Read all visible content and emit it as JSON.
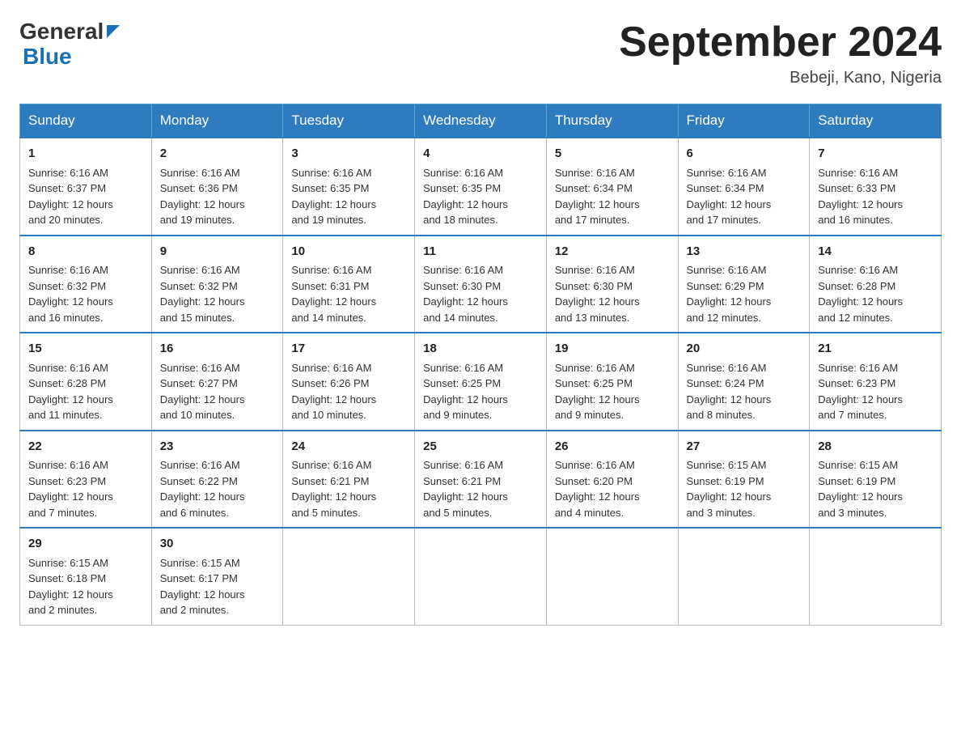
{
  "header": {
    "logo_general": "General",
    "logo_blue": "Blue",
    "month_title": "September 2024",
    "location": "Bebeji, Kano, Nigeria"
  },
  "days_of_week": [
    "Sunday",
    "Monday",
    "Tuesday",
    "Wednesday",
    "Thursday",
    "Friday",
    "Saturday"
  ],
  "weeks": [
    [
      {
        "day": "1",
        "sunrise": "6:16 AM",
        "sunset": "6:37 PM",
        "daylight": "12 hours and 20 minutes."
      },
      {
        "day": "2",
        "sunrise": "6:16 AM",
        "sunset": "6:36 PM",
        "daylight": "12 hours and 19 minutes."
      },
      {
        "day": "3",
        "sunrise": "6:16 AM",
        "sunset": "6:35 PM",
        "daylight": "12 hours and 19 minutes."
      },
      {
        "day": "4",
        "sunrise": "6:16 AM",
        "sunset": "6:35 PM",
        "daylight": "12 hours and 18 minutes."
      },
      {
        "day": "5",
        "sunrise": "6:16 AM",
        "sunset": "6:34 PM",
        "daylight": "12 hours and 17 minutes."
      },
      {
        "day": "6",
        "sunrise": "6:16 AM",
        "sunset": "6:34 PM",
        "daylight": "12 hours and 17 minutes."
      },
      {
        "day": "7",
        "sunrise": "6:16 AM",
        "sunset": "6:33 PM",
        "daylight": "12 hours and 16 minutes."
      }
    ],
    [
      {
        "day": "8",
        "sunrise": "6:16 AM",
        "sunset": "6:32 PM",
        "daylight": "12 hours and 16 minutes."
      },
      {
        "day": "9",
        "sunrise": "6:16 AM",
        "sunset": "6:32 PM",
        "daylight": "12 hours and 15 minutes."
      },
      {
        "day": "10",
        "sunrise": "6:16 AM",
        "sunset": "6:31 PM",
        "daylight": "12 hours and 14 minutes."
      },
      {
        "day": "11",
        "sunrise": "6:16 AM",
        "sunset": "6:30 PM",
        "daylight": "12 hours and 14 minutes."
      },
      {
        "day": "12",
        "sunrise": "6:16 AM",
        "sunset": "6:30 PM",
        "daylight": "12 hours and 13 minutes."
      },
      {
        "day": "13",
        "sunrise": "6:16 AM",
        "sunset": "6:29 PM",
        "daylight": "12 hours and 12 minutes."
      },
      {
        "day": "14",
        "sunrise": "6:16 AM",
        "sunset": "6:28 PM",
        "daylight": "12 hours and 12 minutes."
      }
    ],
    [
      {
        "day": "15",
        "sunrise": "6:16 AM",
        "sunset": "6:28 PM",
        "daylight": "12 hours and 11 minutes."
      },
      {
        "day": "16",
        "sunrise": "6:16 AM",
        "sunset": "6:27 PM",
        "daylight": "12 hours and 10 minutes."
      },
      {
        "day": "17",
        "sunrise": "6:16 AM",
        "sunset": "6:26 PM",
        "daylight": "12 hours and 10 minutes."
      },
      {
        "day": "18",
        "sunrise": "6:16 AM",
        "sunset": "6:25 PM",
        "daylight": "12 hours and 9 minutes."
      },
      {
        "day": "19",
        "sunrise": "6:16 AM",
        "sunset": "6:25 PM",
        "daylight": "12 hours and 9 minutes."
      },
      {
        "day": "20",
        "sunrise": "6:16 AM",
        "sunset": "6:24 PM",
        "daylight": "12 hours and 8 minutes."
      },
      {
        "day": "21",
        "sunrise": "6:16 AM",
        "sunset": "6:23 PM",
        "daylight": "12 hours and 7 minutes."
      }
    ],
    [
      {
        "day": "22",
        "sunrise": "6:16 AM",
        "sunset": "6:23 PM",
        "daylight": "12 hours and 7 minutes."
      },
      {
        "day": "23",
        "sunrise": "6:16 AM",
        "sunset": "6:22 PM",
        "daylight": "12 hours and 6 minutes."
      },
      {
        "day": "24",
        "sunrise": "6:16 AM",
        "sunset": "6:21 PM",
        "daylight": "12 hours and 5 minutes."
      },
      {
        "day": "25",
        "sunrise": "6:16 AM",
        "sunset": "6:21 PM",
        "daylight": "12 hours and 5 minutes."
      },
      {
        "day": "26",
        "sunrise": "6:16 AM",
        "sunset": "6:20 PM",
        "daylight": "12 hours and 4 minutes."
      },
      {
        "day": "27",
        "sunrise": "6:15 AM",
        "sunset": "6:19 PM",
        "daylight": "12 hours and 3 minutes."
      },
      {
        "day": "28",
        "sunrise": "6:15 AM",
        "sunset": "6:19 PM",
        "daylight": "12 hours and 3 minutes."
      }
    ],
    [
      {
        "day": "29",
        "sunrise": "6:15 AM",
        "sunset": "6:18 PM",
        "daylight": "12 hours and 2 minutes."
      },
      {
        "day": "30",
        "sunrise": "6:15 AM",
        "sunset": "6:17 PM",
        "daylight": "12 hours and 2 minutes."
      },
      null,
      null,
      null,
      null,
      null
    ]
  ]
}
